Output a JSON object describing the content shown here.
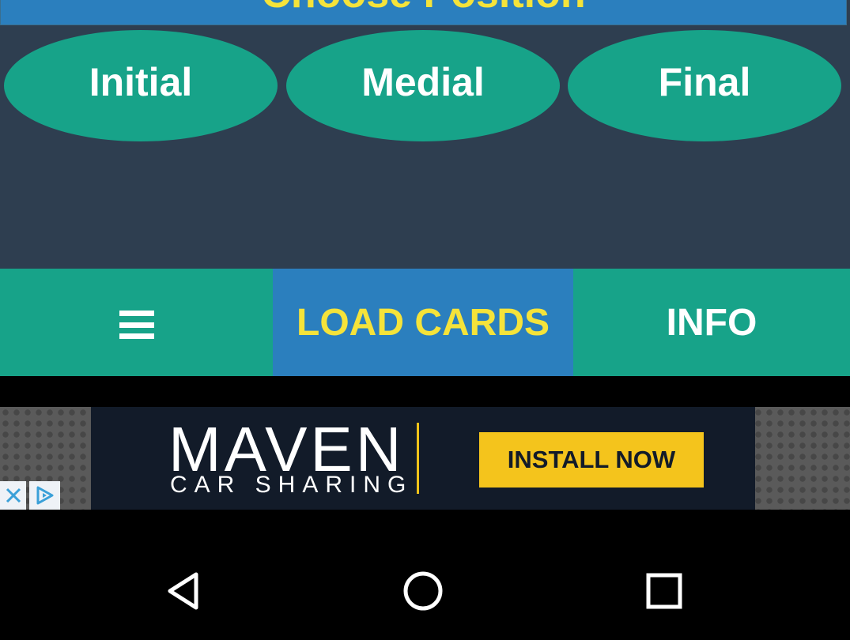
{
  "header": {
    "title": "Choose Position"
  },
  "positions": [
    {
      "label": "Initial"
    },
    {
      "label": "Medial"
    },
    {
      "label": "Final"
    }
  ],
  "bottom_bar": {
    "menu_icon": "hamburger-menu-icon",
    "load_label": "LOAD CARDS",
    "info_label": "INFO"
  },
  "ad": {
    "brand_main": "MAVEN",
    "brand_sub": "CAR SHARING",
    "install_label": "INSTALL NOW",
    "close_icon": "close-icon",
    "adchoices_icon": "adchoices-icon"
  },
  "navbar": {
    "back_icon": "back-triangle-icon",
    "home_icon": "home-circle-icon",
    "recent_icon": "recent-apps-square-icon"
  },
  "colors": {
    "background": "#2e3e50",
    "teal": "#17a389",
    "blue": "#2b7fbe",
    "yellow": "#f5e33a",
    "ad_yellow": "#f4c41c"
  }
}
